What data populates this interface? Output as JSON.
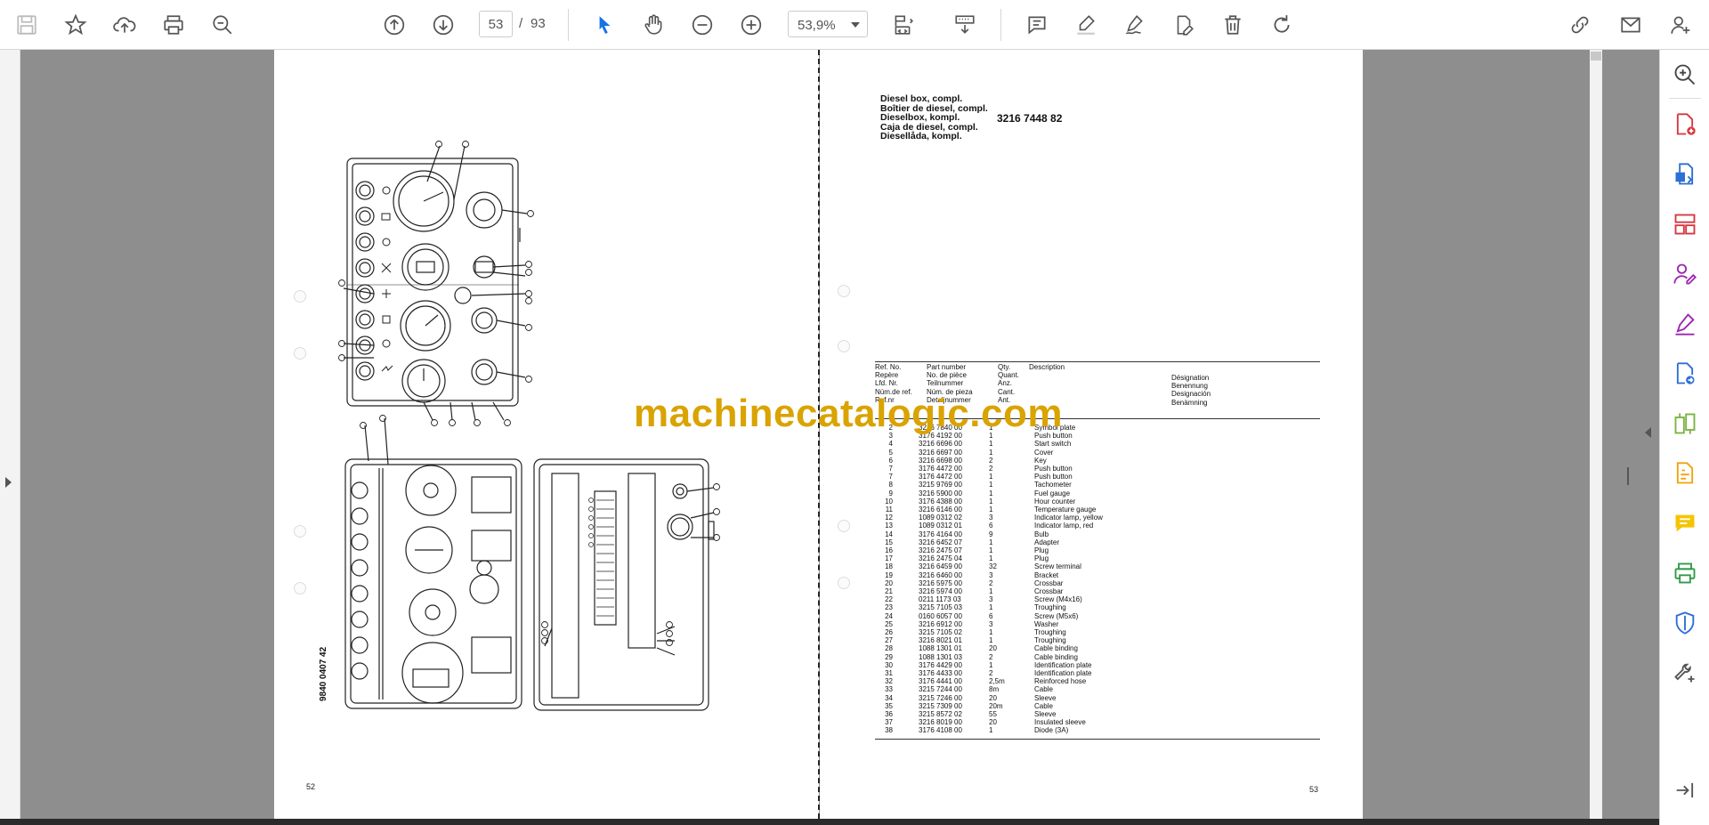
{
  "toolbar": {
    "page_current": "53",
    "page_separator": "/",
    "page_total": "93",
    "zoom": "53,9%",
    "icons": [
      "save-icon",
      "star-icon",
      "upload-icon",
      "print-icon",
      "zoom-search-icon",
      "prev-page-icon",
      "next-page-icon",
      "select-cursor-icon",
      "hand-icon",
      "zoom-out-icon",
      "zoom-in-icon",
      "page-fit-icon",
      "scroll-mode-icon",
      "comment-icon",
      "highlight-icon",
      "sign-icon",
      "edit-icon",
      "delete-icon",
      "rotate-icon",
      "link-icon",
      "mail-icon",
      "account-icon"
    ]
  },
  "left_page": {
    "page_number": "52",
    "drawing_number": "9840 0407 42"
  },
  "right_page": {
    "page_number": "53",
    "title_lines": [
      "Diesel box, compl.",
      "Boîtier de diesel, compl.",
      "Dieselbox, kompl.",
      "Caja de diesel, compl.",
      "Diesellåda, kompl."
    ],
    "part_code": "3216 7448 82",
    "headers": {
      "ref": [
        "Ref. No.",
        "Repère",
        "Lfd. Nr.",
        "Núm.de ref.",
        "Ref.nr"
      ],
      "part": [
        "Part number",
        "No. de pièce",
        "Teilnummer",
        "Núm. de pieza",
        "Detaljnummer"
      ],
      "qty": [
        "Qty.",
        "Quant.",
        "Anz.",
        "Cant.",
        "Ant."
      ],
      "desc": [
        "Description"
      ],
      "desig": [
        "Désignation",
        "Benennung",
        "Designación",
        "Benämning"
      ]
    },
    "rows": [
      {
        "ref": "2",
        "part": "3216 7840 00",
        "qty": "1",
        "desc": "Symbol plate"
      },
      {
        "ref": "3",
        "part": "3176 4192 00",
        "qty": "1",
        "desc": "Push button"
      },
      {
        "ref": "4",
        "part": "3216 6696 00",
        "qty": "1",
        "desc": "Start switch"
      },
      {
        "ref": "5",
        "part": "3216 6697 00",
        "qty": "1",
        "desc": "Cover"
      },
      {
        "ref": "6",
        "part": "3216 6698 00",
        "qty": "2",
        "desc": "Key"
      },
      {
        "ref": "7",
        "part": "3176 4472 00",
        "qty": "2",
        "desc": "Push button"
      },
      {
        "ref": "7",
        "part": "3176 4472 00",
        "qty": "1",
        "desc": "Push button"
      },
      {
        "ref": "8",
        "part": "3215 9769 00",
        "qty": "1",
        "desc": "Tachometer"
      },
      {
        "ref": "9",
        "part": "3216 5900 00",
        "qty": "1",
        "desc": "Fuel gauge"
      },
      {
        "ref": "10",
        "part": "3176 4388 00",
        "qty": "1",
        "desc": "Hour counter"
      },
      {
        "ref": "11",
        "part": "3216 6146 00",
        "qty": "1",
        "desc": "Temperature gauge"
      },
      {
        "ref": "12",
        "part": "1089 0312 02",
        "qty": "3",
        "desc": "Indicator lamp, yellow"
      },
      {
        "ref": "13",
        "part": "1089 0312 01",
        "qty": "6",
        "desc": "Indicator lamp, red"
      },
      {
        "ref": "14",
        "part": "3176 4164 00",
        "qty": "9",
        "desc": "Bulb"
      },
      {
        "ref": "15",
        "part": "3216 6452 07",
        "qty": "1",
        "desc": "Adapter"
      },
      {
        "ref": "16",
        "part": "3216 2475 07",
        "qty": "1",
        "desc": "Plug"
      },
      {
        "ref": "17",
        "part": "3216 2475 04",
        "qty": "1",
        "desc": "Plug"
      },
      {
        "ref": "18",
        "part": "3216 6459 00",
        "qty": "32",
        "desc": "Screw terminal"
      },
      {
        "ref": "19",
        "part": "3216 6460 00",
        "qty": "3",
        "desc": "Bracket"
      },
      {
        "ref": "20",
        "part": "3216 5975 00",
        "qty": "2",
        "desc": "Crossbar"
      },
      {
        "ref": "21",
        "part": "3216 5974 00",
        "qty": "1",
        "desc": "Crossbar"
      },
      {
        "ref": "22",
        "part": "0211 1173 03",
        "qty": "3",
        "desc": "Screw (M4x16)"
      },
      {
        "ref": "23",
        "part": "3215 7105 03",
        "qty": "1",
        "desc": "Troughing"
      },
      {
        "ref": "24",
        "part": "0160 6057 00",
        "qty": "6",
        "desc": "Screw (M5x6)"
      },
      {
        "ref": "25",
        "part": "3216 6912 00",
        "qty": "3",
        "desc": "Washer"
      },
      {
        "ref": "26",
        "part": "3215 7105 02",
        "qty": "1",
        "desc": "Troughing"
      },
      {
        "ref": "27",
        "part": "3216 8021 01",
        "qty": "1",
        "desc": "Troughing"
      },
      {
        "ref": "28",
        "part": "1088 1301 01",
        "qty": "20",
        "desc": "Cable binding"
      },
      {
        "ref": "29",
        "part": "1088 1301 03",
        "qty": "2",
        "desc": "Cable binding"
      },
      {
        "ref": "30",
        "part": "3176 4429 00",
        "qty": "1",
        "desc": "Identification plate"
      },
      {
        "ref": "31",
        "part": "3176 4433 00",
        "qty": "2",
        "desc": "Identification plate"
      },
      {
        "ref": "32",
        "part": "3176 4441 00",
        "qty": "2,5m",
        "desc": "Reinforced hose"
      },
      {
        "ref": "33",
        "part": "3215 7244 00",
        "qty": "8m",
        "desc": "Cable"
      },
      {
        "ref": "34",
        "part": "3215 7246 00",
        "qty": "20",
        "desc": "Sleeve"
      },
      {
        "ref": "35",
        "part": "3215 7309 00",
        "qty": "20m",
        "desc": "Cable"
      },
      {
        "ref": "36",
        "part": "3215 8572 02",
        "qty": "55",
        "desc": "Sleeve"
      },
      {
        "ref": "37",
        "part": "3216 8019 00",
        "qty": "20",
        "desc": "Insulated sleeve"
      },
      {
        "ref": "38",
        "part": "3176 4108 00",
        "qty": "1",
        "desc": "Diode (3A)"
      }
    ]
  },
  "watermark": "machinecatalogic.com",
  "right_panel": {
    "icons": [
      "find-icon",
      "create-pdf-icon",
      "export-pdf-icon",
      "organize-pages-icon",
      "request-signature-icon",
      "fill-sign-icon",
      "send-review-icon",
      "compare-icon",
      "edit-pdf-icon",
      "comment-tool-icon",
      "print-production-icon",
      "protect-icon",
      "more-tools-icon",
      "collapse-panel-icon"
    ]
  }
}
